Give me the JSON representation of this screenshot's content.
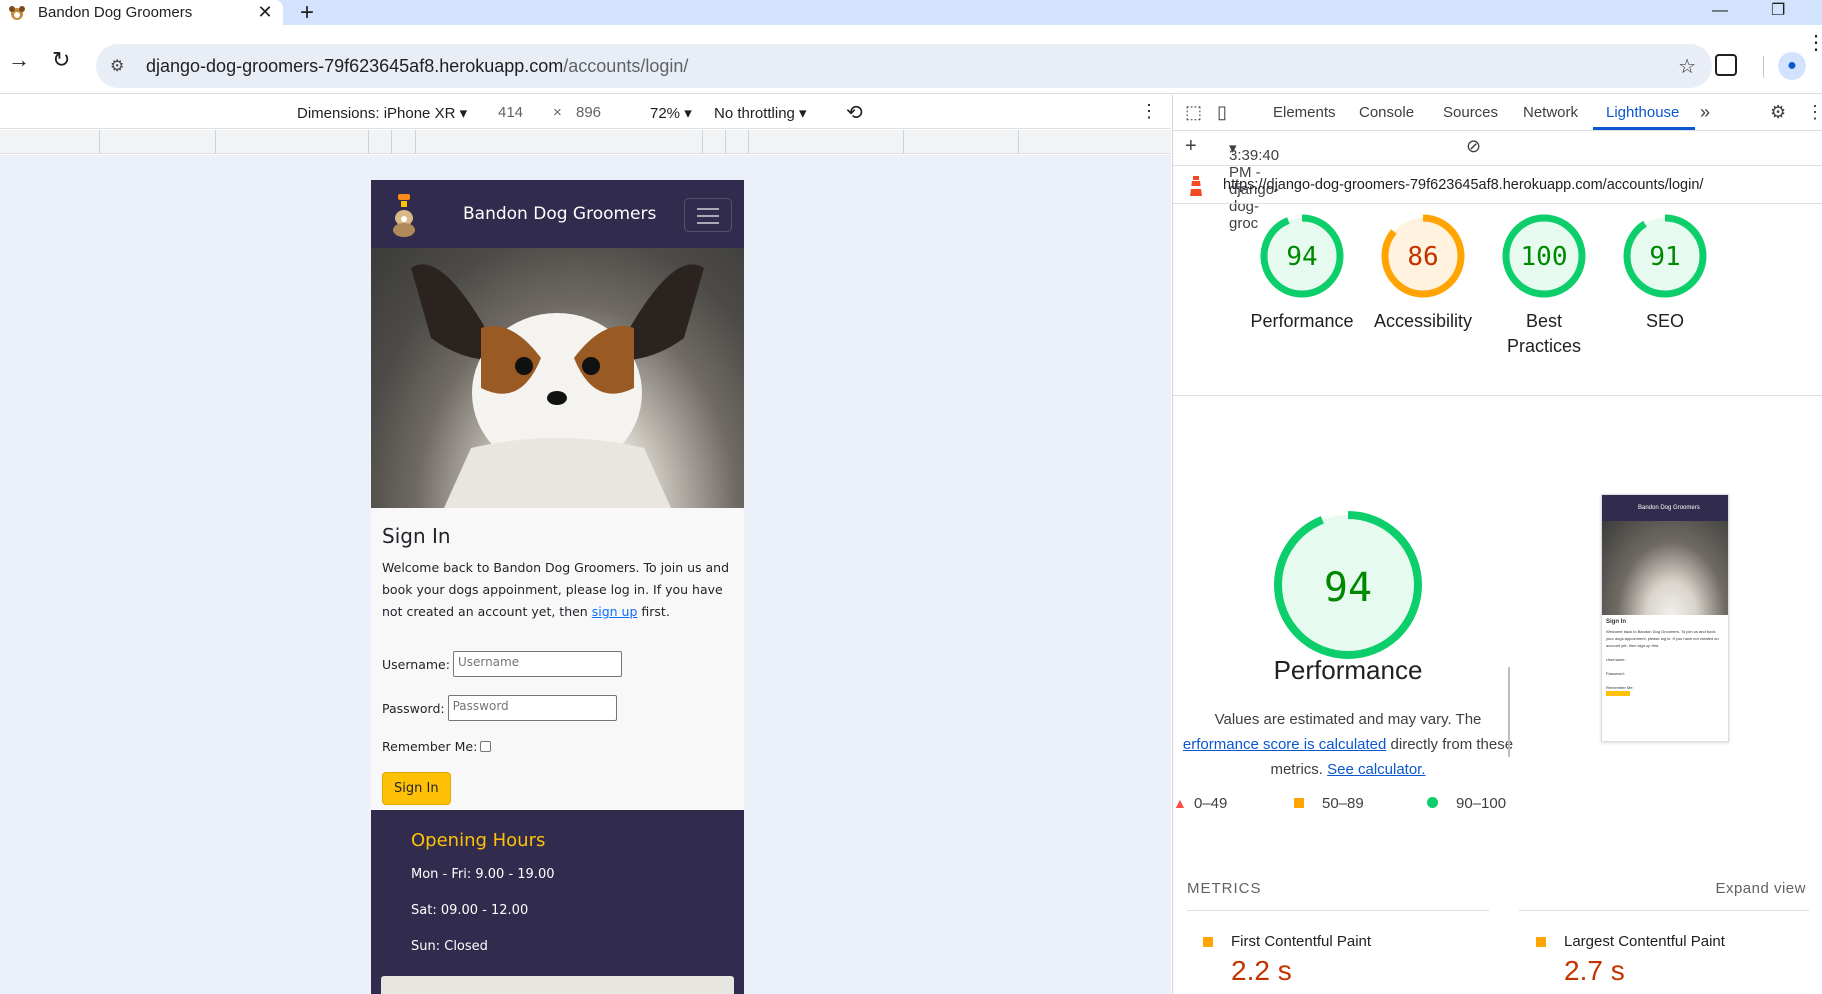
{
  "browser": {
    "tab_title": "Bandon Dog Groomers",
    "url_host": "django-dog-groomers-79f623645af8.herokuapp.com",
    "url_path": "/accounts/login/"
  },
  "device_toolbar": {
    "dimensions_label": "Dimensions: iPhone XR",
    "width": "414",
    "times": "×",
    "height": "896",
    "zoom": "72%",
    "throttling": "No throttling"
  },
  "site": {
    "brand": "Bandon Dog Groomers",
    "sign_in_heading": "Sign In",
    "intro_text": "Welcome back to Bandon Dog Groomers. To join us and book your dogs appoinment, please log in. If you have not created an account yet, then",
    "sign_up_link": "sign up",
    "intro_suffix": "first.",
    "username_label": "Username:",
    "username_placeholder": "Username",
    "password_label": "Password:",
    "password_placeholder": "Password",
    "remember_label": "Remember Me:",
    "sign_in_button": "Sign In",
    "footer": {
      "heading": "Opening Hours",
      "line1": "Mon - Fri: 9.00 - 19.00",
      "line2": "Sat: 09.00 - 12.00",
      "line3": "Sun: Closed"
    }
  },
  "devtools": {
    "tabs": [
      "Elements",
      "Console",
      "Sources",
      "Network",
      "Lighthouse"
    ],
    "active_tab": "Lighthouse",
    "report_label": "3:39:40 PM - django-dog-groc",
    "report_url": "https://django-dog-groomers-79f623645af8.herokuapp.com/accounts/login/"
  },
  "lighthouse": {
    "scores": [
      {
        "label": "Performance",
        "value": 94,
        "color": "#0cce6b",
        "bg": "#e6faef",
        "text": "#008800"
      },
      {
        "label": "Accessibility",
        "value": 86,
        "color": "#ffa400",
        "bg": "#fff3e0",
        "text": "#c33300"
      },
      {
        "label": "Best Practices",
        "value": 100,
        "color": "#0cce6b",
        "bg": "#e6faef",
        "text": "#008800"
      },
      {
        "label": "SEO",
        "value": 91,
        "color": "#0cce6b",
        "bg": "#e6faef",
        "text": "#008800"
      }
    ],
    "big_score": 94,
    "big_title": "Performance",
    "desc_line1": "Values are estimated and may vary. The",
    "desc_link1": "erformance score is calculated",
    "desc_mid": "directly from these",
    "desc_line3_a": "metrics.",
    "desc_link2": "See calculator.",
    "legend": [
      "0–49",
      "50–89",
      "90–100"
    ],
    "metrics_heading": "METRICS",
    "expand_label": "Expand view",
    "metrics": [
      {
        "name": "First Contentful Paint",
        "value": "2.2 s"
      },
      {
        "name": "Largest Contentful Paint",
        "value": "2.7 s"
      }
    ]
  }
}
